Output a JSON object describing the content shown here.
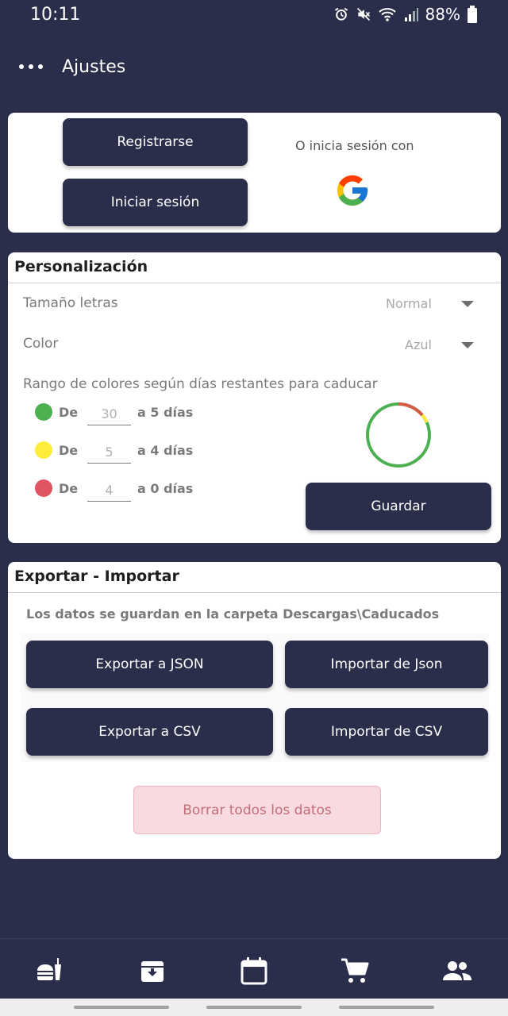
{
  "status": {
    "time": "10:11",
    "battery": "88%"
  },
  "appbar": {
    "title": "Ajustes",
    "menu_icon": "more-dots-icon"
  },
  "login": {
    "register_label": "Registrarse",
    "signin_label": "Iniciar sesión",
    "or_text": "O inicia sesión con",
    "google_icon": "google-icon"
  },
  "personalization": {
    "header": "Personalización",
    "font_size_label": "Tamaño letras",
    "font_size_value": "Normal",
    "color_label": "Color",
    "color_value": "Azul",
    "range_label": "Rango de colores según días restantes para caducar",
    "ranges": [
      {
        "color": "#4caf50",
        "de": "De",
        "value": "30",
        "to": "a 5 días"
      },
      {
        "color": "#ffeb3b",
        "de": "De",
        "value": "5",
        "to": "a 4 días"
      },
      {
        "color": "#e05561",
        "de": "De",
        "value": "4",
        "to": "a 0 días"
      }
    ],
    "save_label": "Guardar"
  },
  "export": {
    "header": "Exportar - Importar",
    "info": "Los datos se guardan en la carpeta Descargas\\Caducados",
    "export_json": "Exportar a JSON",
    "import_json": "Importar de Json",
    "export_csv": "Exportar a CSV",
    "import_csv": "Importar de CSV",
    "delete_all": "Borrar todos los datos"
  },
  "bottom_nav": [
    "food-icon",
    "archive-icon",
    "calendar-icon",
    "cart-icon",
    "people-icon"
  ],
  "colors": {
    "primary": "#2b2e4b",
    "background": "#2a2e4a",
    "danger_bg": "#f8dbe0",
    "danger_text": "#c56d79"
  }
}
